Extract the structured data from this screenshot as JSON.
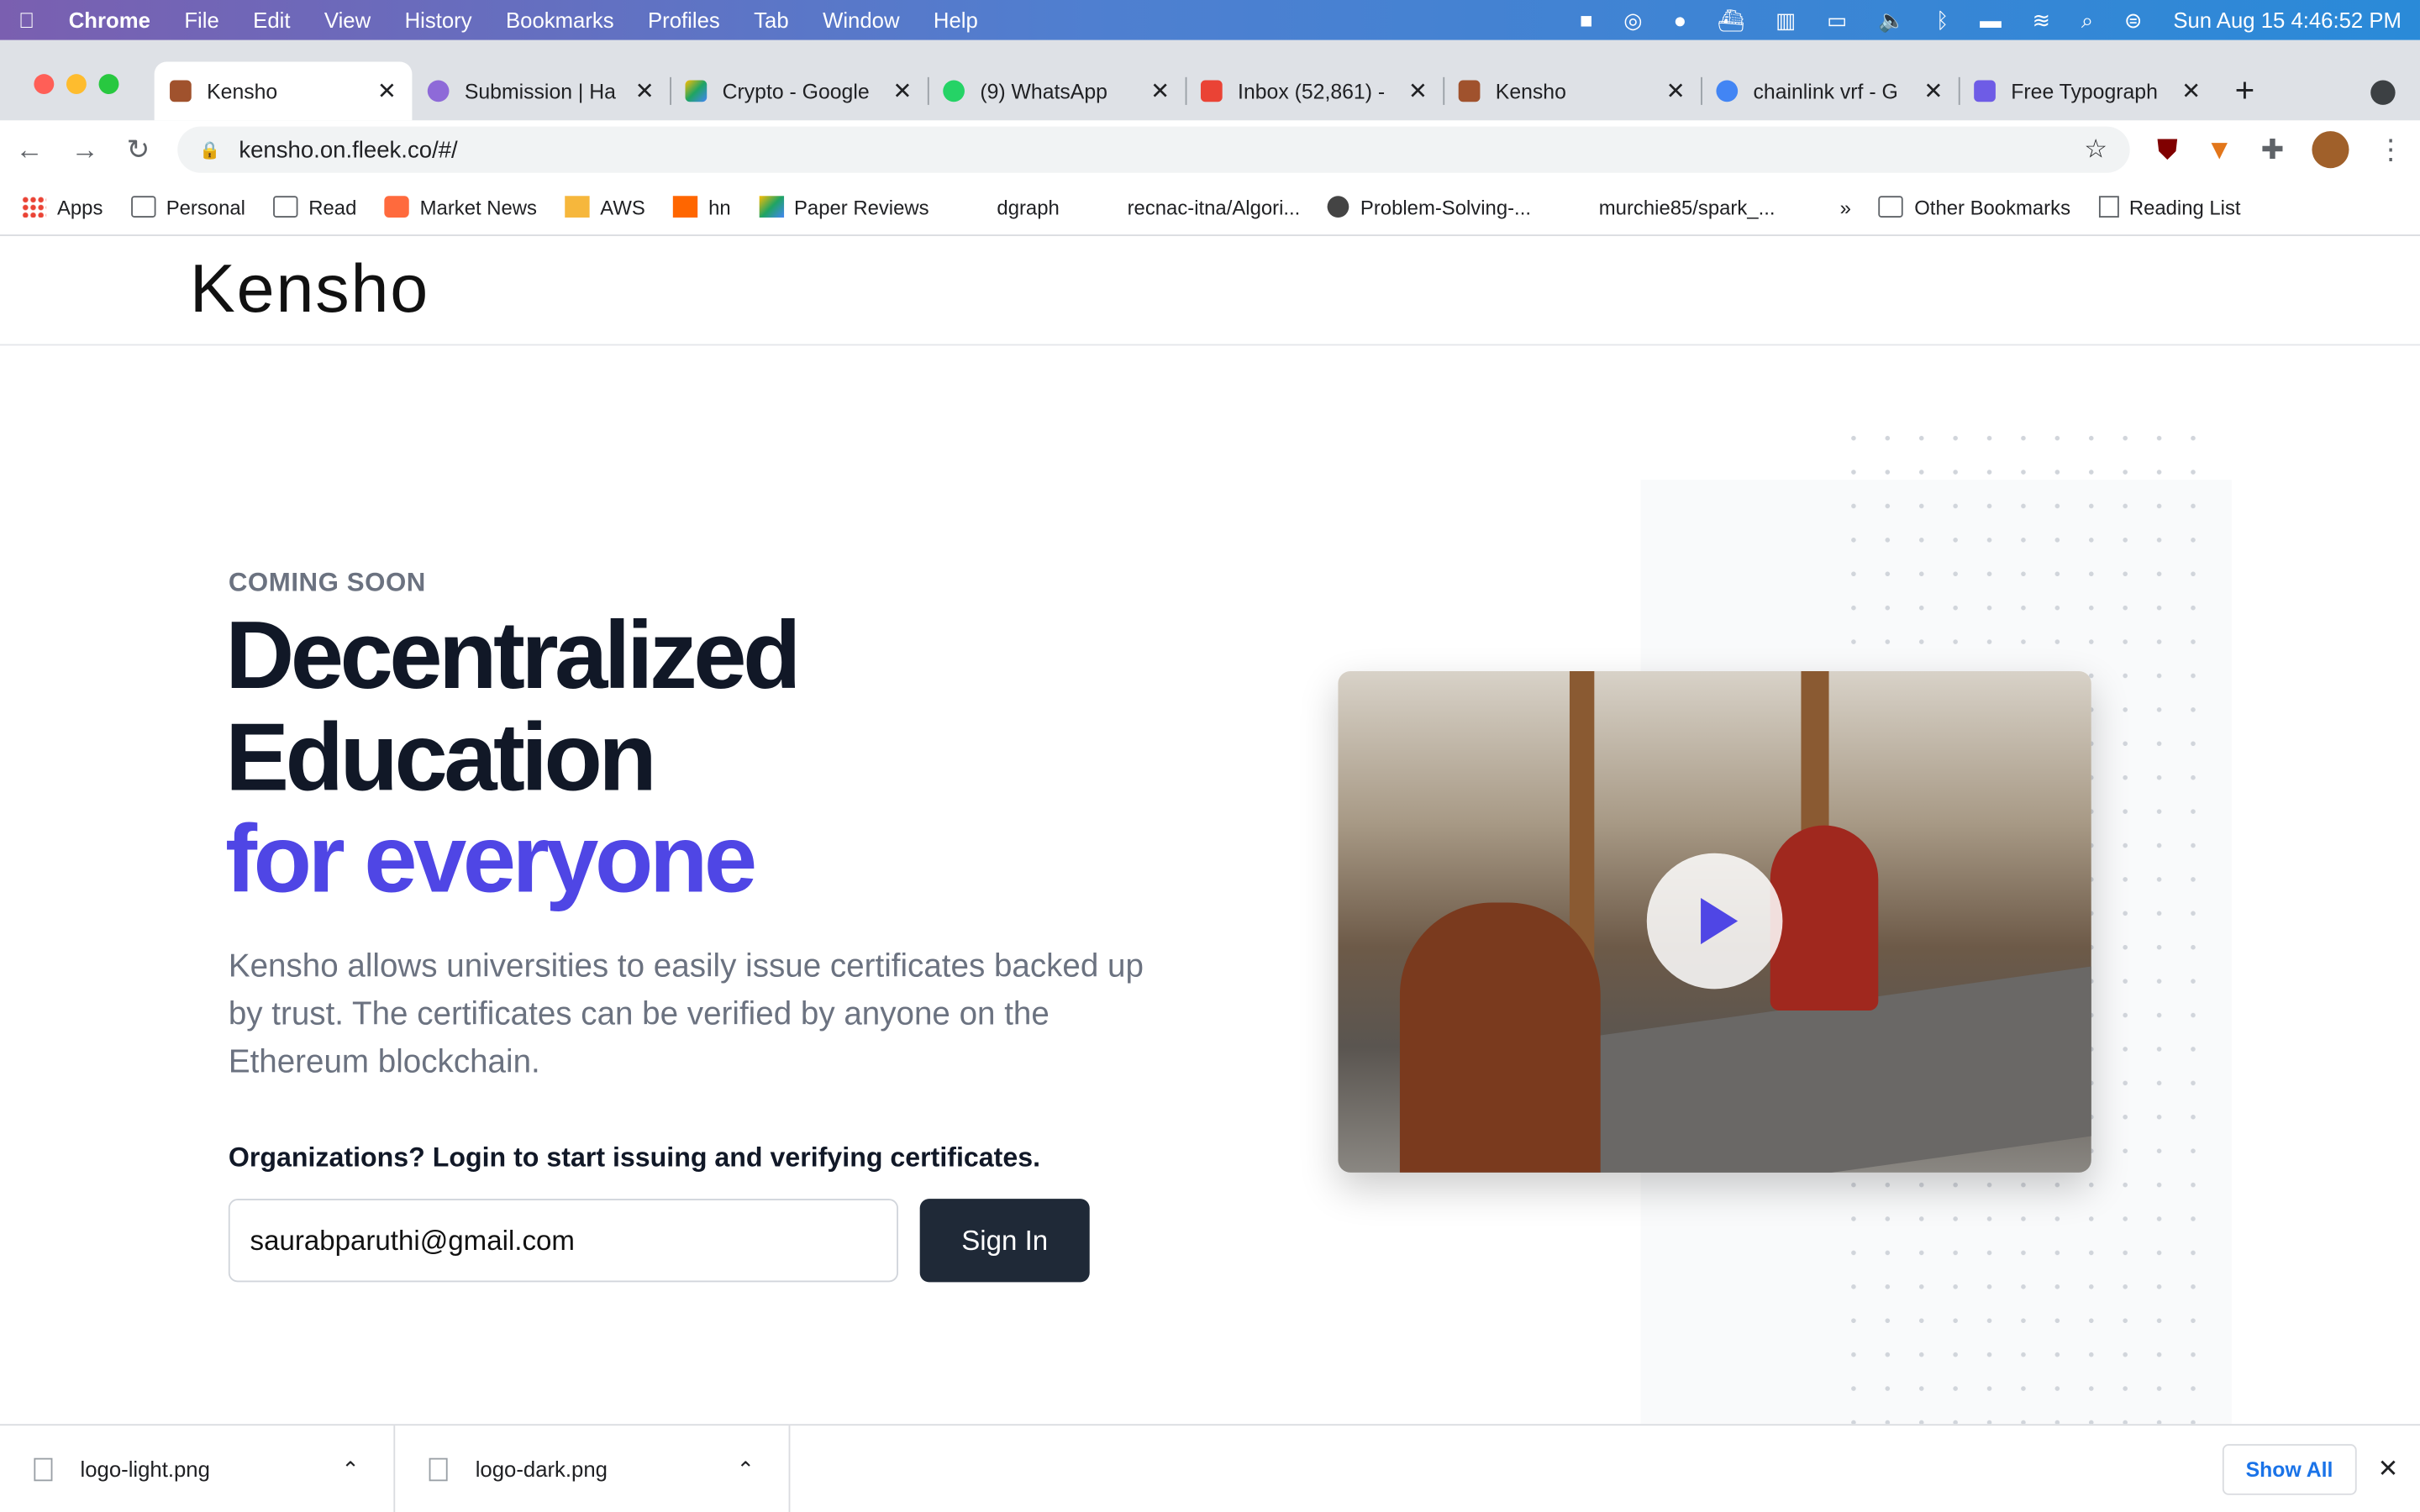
{
  "menubar": {
    "app": "Chrome",
    "items": [
      "File",
      "Edit",
      "View",
      "History",
      "Bookmarks",
      "Profiles",
      "Tab",
      "Window",
      "Help"
    ],
    "clock": "Sun Aug 15  4:46:52 PM"
  },
  "tabs": [
    {
      "title": "Kensho",
      "active": true,
      "color": "#a0522d"
    },
    {
      "title": "Submission | Ha",
      "color": "#8e6ad8"
    },
    {
      "title": "Crypto - Google",
      "color": "#1fa463"
    },
    {
      "title": "(9) WhatsApp",
      "color": "#25d366"
    },
    {
      "title": "Inbox (52,861) -",
      "color": "#ea4335"
    },
    {
      "title": "Kensho",
      "color": "#a0522d"
    },
    {
      "title": "chainlink vrf - G",
      "color": "#4285f4"
    },
    {
      "title": "Free Typograph",
      "color": "#6e5ce6"
    }
  ],
  "address": {
    "url": "kensho.on.fleek.co/#/"
  },
  "bookmarks": [
    {
      "label": "Apps",
      "icon": "apps-grid"
    },
    {
      "label": "Personal",
      "icon": "folder"
    },
    {
      "label": "Read",
      "icon": "folder"
    },
    {
      "label": "Market News",
      "icon": "alpha"
    },
    {
      "label": "AWS",
      "icon": "box"
    },
    {
      "label": "hn",
      "icon": "y-combinator"
    },
    {
      "label": "Paper Reviews",
      "icon": "drive"
    },
    {
      "label": "dgraph",
      "icon": ""
    },
    {
      "label": "recnac-itna/Algori...",
      "icon": ""
    },
    {
      "label": "Problem-Solving-...",
      "icon": "github"
    },
    {
      "label": "murchie85/spark_...",
      "icon": ""
    }
  ],
  "bookmarks_more": "»",
  "other_bookmarks": "Other Bookmarks",
  "reading_list": "Reading List",
  "site": {
    "logo": "Kensho",
    "eyebrow": "COMING SOON",
    "headline_1": "Decentralized",
    "headline_2": "Education",
    "headline_accent": "for everyone",
    "description": "Kensho allows universities to easily issue certificates backed up by trust. The certificates can be verified by anyone on the Ethereum blockchain.",
    "org_prompt": "Organizations? Login to start issuing and verifying certificates.",
    "email_value": "saurabparuthi@gmail.com",
    "sign_in": "Sign In",
    "accent_color": "#4f46e5"
  },
  "downloads": {
    "items": [
      "logo-light.png",
      "logo-dark.png"
    ],
    "show_all": "Show All"
  }
}
